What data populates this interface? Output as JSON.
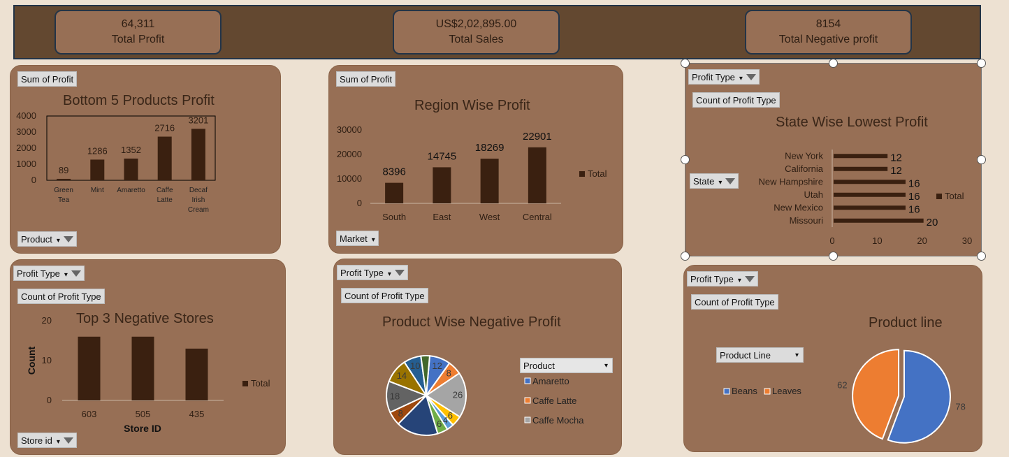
{
  "kpis": [
    {
      "value": "64,311",
      "label": "Total Profit"
    },
    {
      "value": "US$2,02,895.00",
      "label": "Total Sales"
    },
    {
      "value": "8154",
      "label": "Total Negative profit"
    }
  ],
  "buttons": {
    "sum_profit": "Sum of Profit",
    "product": "Product",
    "market": "Market",
    "profit_type": "Profit Type",
    "count_profit_type": "Count of Profit Type",
    "state": "State",
    "store_id": "Store id",
    "product_line": "Product Line"
  },
  "colors": {
    "bar": "#3a2010",
    "panel": "#976f55",
    "header": "#634830"
  },
  "chart_data": [
    {
      "type": "bar",
      "title": "Bottom 5 Products Profit",
      "categories": [
        "Green Tea",
        "Mint",
        "Amaretto",
        "Caffe Latte",
        "Decaf Irish Cream"
      ],
      "values": [
        89,
        1286,
        1352,
        2716,
        3201
      ],
      "yticks": [
        "4000",
        "3000",
        "2000",
        "1000",
        "0"
      ],
      "ylim": [
        0,
        4000
      ]
    },
    {
      "type": "bar",
      "title": "Region Wise Profit",
      "categories": [
        "South",
        "East",
        "West",
        "Central"
      ],
      "values": [
        8396,
        14745,
        18269,
        22901
      ],
      "yticks": [
        "30000",
        "20000",
        "10000",
        "0"
      ],
      "ylim": [
        0,
        30000
      ],
      "legend": "Total"
    },
    {
      "type": "bar",
      "orientation": "horizontal",
      "title": "State Wise Lowest Profit",
      "categories": [
        "New York",
        "California",
        "New Hampshire",
        "Utah",
        "New Mexico",
        "Missouri"
      ],
      "values": [
        12,
        12,
        16,
        16,
        16,
        20
      ],
      "xticks": [
        "0",
        "10",
        "20",
        "30"
      ],
      "xlim": [
        0,
        30
      ],
      "legend": "Total"
    },
    {
      "type": "bar",
      "title": "Top 3 Negative Stores",
      "categories": [
        "603",
        "505",
        "435"
      ],
      "values": [
        16,
        16,
        13
      ],
      "yticks": [
        "20",
        "10",
        "0"
      ],
      "ylim": [
        0,
        20
      ],
      "xlabel": "Store ID",
      "ylabel": "Count",
      "legend": "Total"
    },
    {
      "type": "pie",
      "title": "Product Wise Negative Profit",
      "slices": [
        {
          "label": "12",
          "value": 12,
          "color": "#4472c4"
        },
        {
          "label": "8",
          "value": 8,
          "color": "#ed7d31"
        },
        {
          "label": "26",
          "value": 26,
          "color": "#a5a5a5"
        },
        {
          "label": "6",
          "value": 6,
          "color": "#ffc000"
        },
        {
          "label": "4",
          "value": 4,
          "color": "#5b9bd5"
        },
        {
          "label": "6",
          "value": 6,
          "color": "#70ad47"
        },
        {
          "label": "",
          "value": 24,
          "color": "#264478"
        },
        {
          "label": "8",
          "value": 8,
          "color": "#9e480e"
        },
        {
          "label": "18",
          "value": 18,
          "color": "#636363"
        },
        {
          "label": "14",
          "value": 14,
          "color": "#997300"
        },
        {
          "label": "10",
          "value": 10,
          "color": "#255e91"
        },
        {
          "label": "",
          "value": 5,
          "color": "#43682b"
        }
      ],
      "legend_items": [
        {
          "name": "Amaretto",
          "color": "#4472c4"
        },
        {
          "name": "Caffe Latte",
          "color": "#ed7d31"
        },
        {
          "name": "Caffe Mocha",
          "color": "#a5a5a5"
        }
      ]
    },
    {
      "type": "pie",
      "title": "Product line",
      "slices": [
        {
          "label": "78",
          "value": 78,
          "color": "#4472c4"
        },
        {
          "label": "62",
          "value": 62,
          "color": "#ed7d31"
        }
      ],
      "legend_items": [
        {
          "name": "Beans",
          "color": "#4472c4"
        },
        {
          "name": "Leaves",
          "color": "#ed7d31"
        }
      ]
    }
  ]
}
